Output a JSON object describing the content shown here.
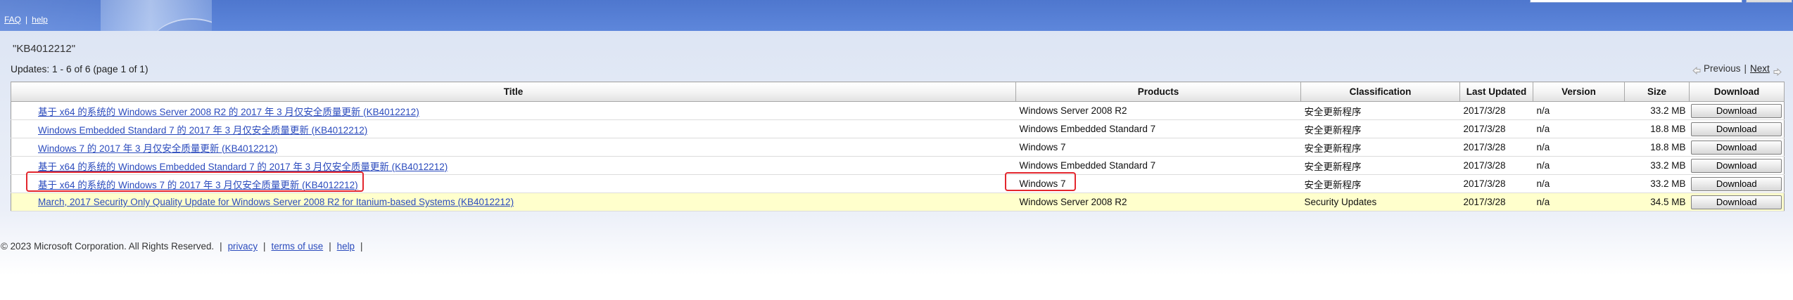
{
  "header": {
    "links": [
      "FAQ",
      "help"
    ],
    "separator": "|"
  },
  "search_query": "\"KB4012212\"",
  "results_summary": "Updates: 1 - 6 of 6 (page 1 of 1)",
  "pagination": {
    "previous_label": "Previous",
    "separator": "|",
    "next_label": "Next",
    "previous_icon": "arrow-left-icon",
    "next_icon": "arrow-right-icon"
  },
  "table": {
    "columns": [
      "Title",
      "Products",
      "Classification",
      "Last Updated",
      "Version",
      "Size",
      "Download"
    ],
    "rows": [
      {
        "title": "基于 x64 的系统的 Windows Server 2008 R2 的 2017 年 3 月仅安全质量更新 (KB4012212)",
        "product": "Windows Server 2008 R2",
        "classification": "安全更新程序",
        "last_updated": "2017/3/28",
        "version": "n/a",
        "size": "33.2 MB",
        "download_label": "Download"
      },
      {
        "title": "Windows Embedded Standard 7 的 2017 年 3 月仅安全质量更新 (KB4012212)",
        "product": "Windows Embedded Standard 7",
        "classification": "安全更新程序",
        "last_updated": "2017/3/28",
        "version": "n/a",
        "size": "18.8 MB",
        "download_label": "Download"
      },
      {
        "title": "Windows 7 的 2017 年 3 月仅安全质量更新 (KB4012212)",
        "product": "Windows 7",
        "classification": "安全更新程序",
        "last_updated": "2017/3/28",
        "version": "n/a",
        "size": "18.8 MB",
        "download_label": "Download"
      },
      {
        "title": "基于 x64 的系统的 Windows Embedded Standard 7 的 2017 年 3 月仅安全质量更新 (KB4012212)",
        "product": "Windows Embedded Standard 7",
        "classification": "安全更新程序",
        "last_updated": "2017/3/28",
        "version": "n/a",
        "size": "33.2 MB",
        "download_label": "Download"
      },
      {
        "title": "基于 x64 的系统的 Windows 7 的 2017 年 3 月仅安全质量更新 (KB4012212)",
        "product": "Windows 7",
        "classification": "安全更新程序",
        "last_updated": "2017/3/28",
        "version": "n/a",
        "size": "33.2 MB",
        "download_label": "Download"
      },
      {
        "title": "March, 2017 Security Only Quality Update for Windows Server 2008 R2 for Itanium-based Systems (KB4012212)",
        "product": "Windows Server 2008 R2",
        "classification": "Security Updates",
        "last_updated": "2017/3/28",
        "version": "n/a",
        "size": "34.5 MB",
        "download_label": "Download"
      }
    ]
  },
  "footer": {
    "copyright": "© 2023 Microsoft Corporation. All Rights Reserved.",
    "separator": "|",
    "links": [
      "privacy",
      "terms of use",
      "help"
    ]
  },
  "colors": {
    "header_bar": "#5580d9",
    "link": "#2b4bbd",
    "highlighted_row": "#ffffcc",
    "annotation": "#e3262d"
  }
}
